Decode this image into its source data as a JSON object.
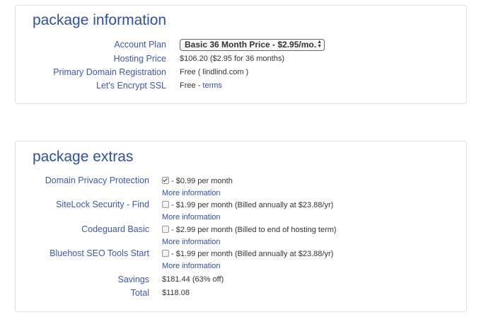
{
  "package_info": {
    "title": "package information",
    "account_plan_label": "Account Plan",
    "account_plan_selected": "Basic 36 Month Price - $2.95/mo.",
    "hosting_price_label": "Hosting Price",
    "hosting_price_value": "$106.20",
    "hosting_price_detail": "($2.95 for 36 months)",
    "domain_label": "Primary Domain Registration",
    "domain_value": "Free",
    "domain_detail": "( lindlind.com )",
    "ssl_label": "Let's Encrypt SSL",
    "ssl_value": "Free",
    "ssl_separator": "-",
    "ssl_terms_link": "terms"
  },
  "package_extras": {
    "title": "package extras",
    "items": [
      {
        "label": "Domain Privacy Protection",
        "checked": true,
        "price": "- $0.99 per month",
        "more": "More information"
      },
      {
        "label": "SiteLock Security - Find",
        "checked": false,
        "price": "- $1.99 per month (Billed annually at $23.88/yr)",
        "more": "More information"
      },
      {
        "label": "Codeguard Basic",
        "checked": false,
        "price": "- $2.99 per month (Billed to end of hosting term)",
        "more": "More information"
      },
      {
        "label": "Bluehost SEO Tools Start",
        "checked": false,
        "price": "- $1.99 per month (Billed annually at $23.88/yr)",
        "more": "More information"
      }
    ],
    "savings_label": "Savings",
    "savings_value": "$181.44 (63% off)",
    "total_label": "Total",
    "total_value": "$118.08"
  },
  "colors": {
    "label_blue": "#3d58b0",
    "title_blue": "#2e4fa6",
    "panel_border": "#d9e2ea"
  }
}
